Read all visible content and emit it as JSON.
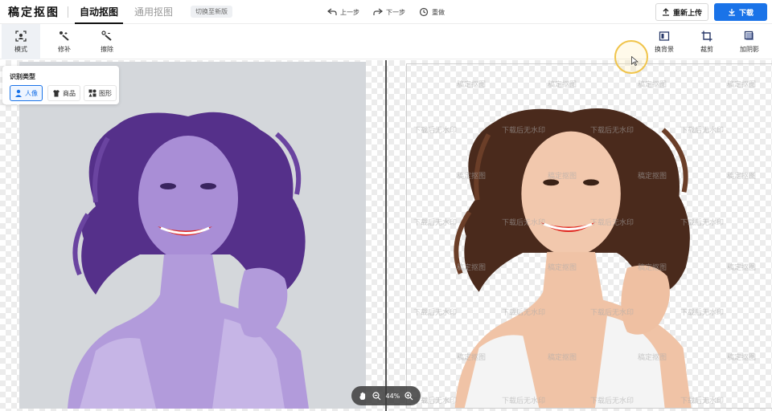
{
  "header": {
    "logo": "稿定抠图",
    "tabs": [
      {
        "label": "自动抠图",
        "active": true
      },
      {
        "label": "通用抠图",
        "active": false
      }
    ],
    "switch_badge": "切换至新版",
    "undo_label": "上一步",
    "redo_label": "下一步",
    "reset_label": "重做",
    "reupload_label": "重新上传",
    "download_label": "下载",
    "download_color": "#1a73e8"
  },
  "toolbar": {
    "left_tools": [
      {
        "label": "模式",
        "icon": "mode-icon",
        "active": true
      },
      {
        "label": "修补",
        "icon": "repair-brush-icon",
        "active": false
      },
      {
        "label": "擦除",
        "icon": "erase-brush-icon",
        "active": false
      }
    ],
    "right_tools": [
      {
        "label": "换背景",
        "icon": "background-icon"
      },
      {
        "label": "裁剪",
        "icon": "crop-icon"
      },
      {
        "label": "加阴影",
        "icon": "shadow-icon"
      }
    ]
  },
  "recognition": {
    "title": "识别类型",
    "options": [
      {
        "label": "人像",
        "icon": "person-icon",
        "selected": true
      },
      {
        "label": "商品",
        "icon": "shirt-icon",
        "selected": false
      },
      {
        "label": "图形",
        "icon": "shapes-icon",
        "selected": false
      }
    ]
  },
  "watermarks": {
    "logo_text": "稿定抠图",
    "download_text": "下载后无水印"
  },
  "zoom": {
    "level": "44%"
  },
  "colors": {
    "accent": "#1a73e8",
    "cursor_ring": "#f0c44a",
    "purple_tint": "#6b4fa8"
  }
}
